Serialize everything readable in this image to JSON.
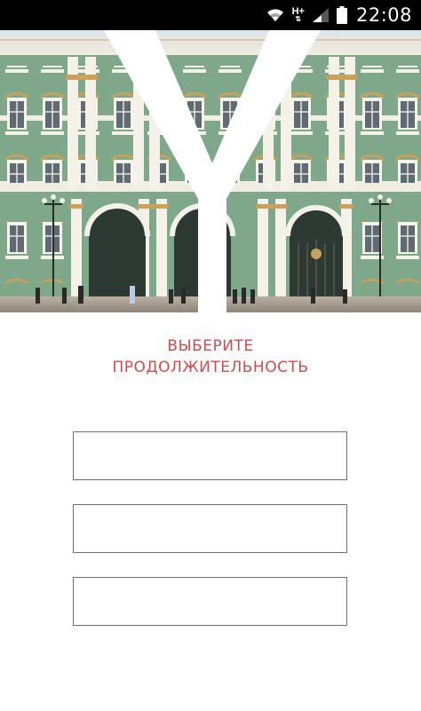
{
  "status_bar": {
    "time": "22:08",
    "network_label": "H+",
    "icons": [
      "wifi-icon",
      "network-type-icon",
      "signal-icon",
      "battery-icon"
    ]
  },
  "hero": {
    "logo_letter": "Y",
    "image": "winter-palace-facade",
    "colors": {
      "facade": "#7fa88a",
      "columns": "#f4f1e8",
      "trim": "#c9a15a",
      "sky": "#dfe7ee"
    }
  },
  "heading": {
    "line1": "ВЫБЕРИТЕ",
    "line2": "ПРОДОЛЖИТЕЛЬНОСТЬ",
    "color": "#d24a4f"
  },
  "options": [
    {
      "label": ""
    },
    {
      "label": ""
    },
    {
      "label": ""
    }
  ]
}
